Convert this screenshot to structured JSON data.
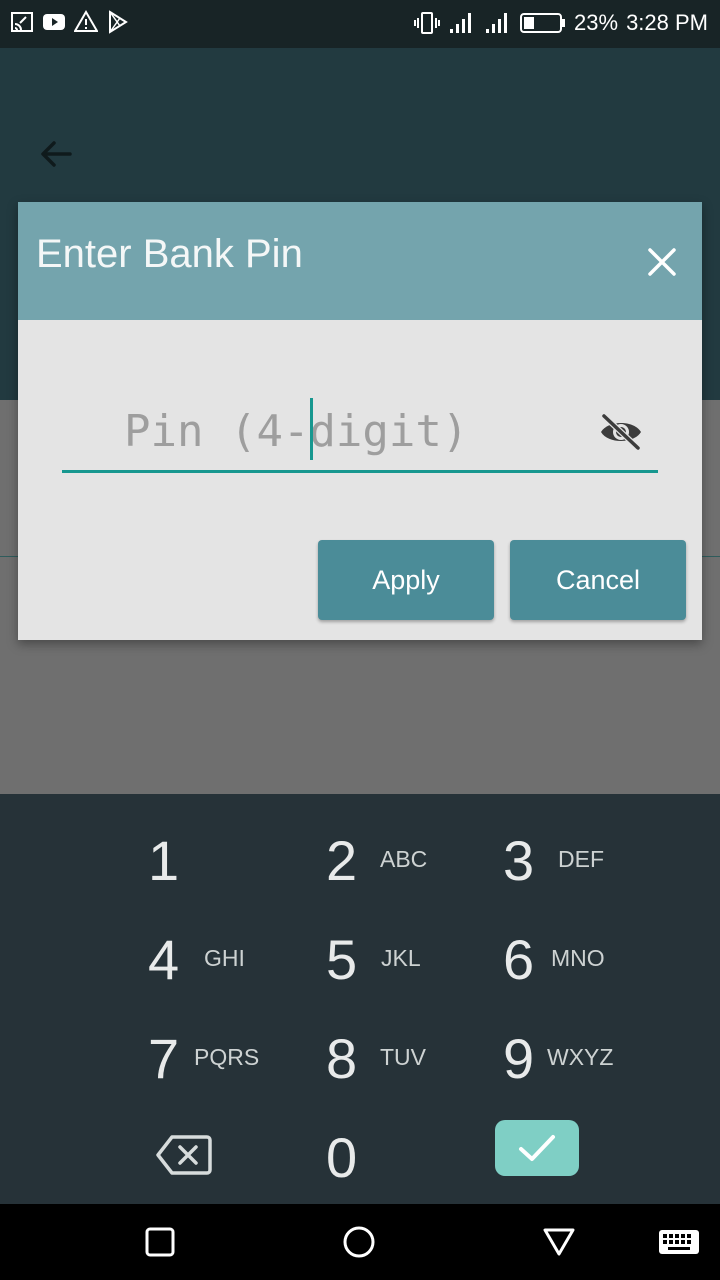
{
  "status_bar": {
    "icons_left": [
      "cast-icon",
      "youtube-icon",
      "warning-icon",
      "play-store-icon"
    ],
    "battery_percent": "23%",
    "time": "3:28 PM"
  },
  "dialog": {
    "title": "Enter Bank Pin",
    "pin_placeholder": "Pin (4-digit)",
    "pin_value": "",
    "apply_label": "Apply",
    "cancel_label": "Cancel"
  },
  "keypad": {
    "keys": [
      {
        "num": "1",
        "letters": ""
      },
      {
        "num": "2",
        "letters": "ABC"
      },
      {
        "num": "3",
        "letters": "DEF"
      },
      {
        "num": "4",
        "letters": "GHI"
      },
      {
        "num": "5",
        "letters": "JKL"
      },
      {
        "num": "6",
        "letters": "MNO"
      },
      {
        "num": "7",
        "letters": "PQRS"
      },
      {
        "num": "8",
        "letters": "TUV"
      },
      {
        "num": "9",
        "letters": "WXYZ"
      },
      {
        "num": "0",
        "letters": ""
      }
    ]
  },
  "colors": {
    "dialog_header": "#74a4ad",
    "accent": "#17978f",
    "button": "#4b8c98",
    "keypad_bg": "#263238",
    "done_key": "#7fcfc5"
  }
}
